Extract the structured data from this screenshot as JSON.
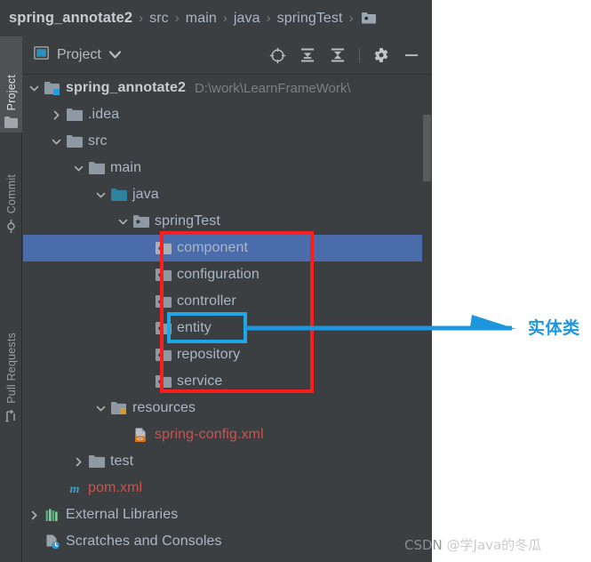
{
  "breadcrumb": {
    "items": [
      {
        "label": "spring_annotate2",
        "type": "project"
      },
      {
        "label": "src",
        "type": "folder"
      },
      {
        "label": "main",
        "type": "folder"
      },
      {
        "label": "java",
        "type": "folder"
      },
      {
        "label": "springTest",
        "type": "package"
      }
    ],
    "separator": "›",
    "trailing_icon": "package-folder-icon"
  },
  "left_strip": {
    "tabs": [
      {
        "label": "Project",
        "icon": "project-folder-icon",
        "active": true
      },
      {
        "label": "Commit",
        "icon": "commit-icon",
        "active": false
      },
      {
        "label": "Pull Requests",
        "icon": "pull-request-icon",
        "active": false
      }
    ]
  },
  "panel": {
    "title": "Project",
    "dropdown_icon": "chevron-down-icon",
    "view_icon": "project-view-icon",
    "toolbar_buttons": [
      {
        "name": "locate-icon",
        "tooltip": "Select Opened File"
      },
      {
        "name": "expand-all-icon",
        "tooltip": "Expand All"
      },
      {
        "name": "collapse-all-icon",
        "tooltip": "Collapse All"
      },
      {
        "name": "settings-gear-icon",
        "tooltip": "Settings"
      },
      {
        "name": "hide-icon",
        "tooltip": "Hide"
      }
    ]
  },
  "tree": {
    "nodes": [
      {
        "label": "spring_annotate2",
        "path": "D:\\work\\LearnFrameWork\\",
        "icon": "project-module-icon",
        "arrow": "down",
        "indent": 0,
        "style": "bold",
        "selected": false
      },
      {
        "label": ".idea",
        "path": "",
        "icon": "folder-icon",
        "arrow": "right",
        "indent": 1,
        "style": "normal",
        "selected": false
      },
      {
        "label": "src",
        "path": "",
        "icon": "folder-icon",
        "arrow": "down",
        "indent": 1,
        "style": "normal",
        "selected": false
      },
      {
        "label": "main",
        "path": "",
        "icon": "folder-icon",
        "arrow": "down",
        "indent": 2,
        "style": "normal",
        "selected": false
      },
      {
        "label": "java",
        "path": "",
        "icon": "source-root-folder-icon",
        "arrow": "down",
        "indent": 3,
        "style": "normal",
        "selected": false
      },
      {
        "label": "springTest",
        "path": "",
        "icon": "package-icon",
        "arrow": "down",
        "indent": 4,
        "style": "normal",
        "selected": false
      },
      {
        "label": "component",
        "path": "",
        "icon": "package-icon",
        "arrow": "none",
        "indent": 5,
        "style": "normal",
        "selected": true
      },
      {
        "label": "configuration",
        "path": "",
        "icon": "package-icon",
        "arrow": "none",
        "indent": 5,
        "style": "normal",
        "selected": false
      },
      {
        "label": "controller",
        "path": "",
        "icon": "package-icon",
        "arrow": "none",
        "indent": 5,
        "style": "normal",
        "selected": false
      },
      {
        "label": "entity",
        "path": "",
        "icon": "package-icon",
        "arrow": "none",
        "indent": 5,
        "style": "normal",
        "selected": false
      },
      {
        "label": "repository",
        "path": "",
        "icon": "package-icon",
        "arrow": "none",
        "indent": 5,
        "style": "normal",
        "selected": false
      },
      {
        "label": "service",
        "path": "",
        "icon": "package-icon",
        "arrow": "none",
        "indent": 5,
        "style": "normal",
        "selected": false
      },
      {
        "label": "resources",
        "path": "",
        "icon": "resources-root-folder-icon",
        "arrow": "down",
        "indent": 3,
        "style": "normal",
        "selected": false
      },
      {
        "label": "spring-config.xml",
        "path": "",
        "icon": "xml-file-icon",
        "arrow": "none",
        "indent": 4,
        "style": "modified",
        "selected": false
      },
      {
        "label": "test",
        "path": "",
        "icon": "folder-icon",
        "arrow": "right",
        "indent": 2,
        "style": "normal",
        "selected": false
      },
      {
        "label": "pom.xml",
        "path": "",
        "icon": "maven-file-icon",
        "arrow": "none",
        "indent": 1,
        "style": "modified",
        "selected": false
      },
      {
        "label": "External Libraries",
        "path": "",
        "icon": "libraries-icon",
        "arrow": "right",
        "indent": 0,
        "style": "normal",
        "selected": false
      },
      {
        "label": "Scratches and Consoles",
        "path": "",
        "icon": "scratches-icon",
        "arrow": "none",
        "indent": 0,
        "style": "normal",
        "selected": false
      }
    ]
  },
  "annotations": {
    "red_box_label": "packages-highlight-box",
    "cyan_box_label": "entity-highlight-box",
    "arrow_label": "实体类",
    "arrow_color": "#1e96dd",
    "red_color": "#fa1f1f",
    "cyan_color": "#21a7e8"
  },
  "watermark": {
    "prefix": "CSDN ",
    "handle": "@学Java的冬瓜"
  }
}
